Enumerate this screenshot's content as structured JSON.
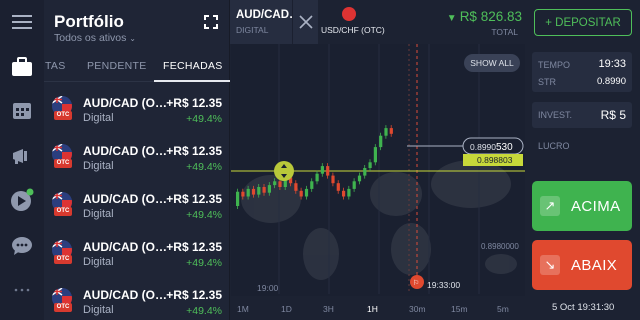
{
  "portfolio": {
    "title": "Portfólio",
    "subtitle": "Todos os ativos",
    "tabs": [
      {
        "label": "TAS"
      },
      {
        "label": "PENDENTE"
      },
      {
        "label": "FECHADAS"
      }
    ],
    "active_tab": "FECHADAS",
    "trades": [
      {
        "pair": "AUD/CAD (O…",
        "type": "Digital",
        "amount": "+R$ 12.35",
        "percent": "+49.4%",
        "badge": "OTC"
      },
      {
        "pair": "AUD/CAD (O…",
        "type": "Digital",
        "amount": "+R$ 12.35",
        "percent": "+49.4%",
        "badge": "OTC"
      },
      {
        "pair": "AUD/CAD (O…",
        "type": "Digital",
        "amount": "+R$ 12.35",
        "percent": "+49.4%",
        "badge": "OTC"
      },
      {
        "pair": "AUD/CAD (O…",
        "type": "Digital",
        "amount": "+R$ 12.35",
        "percent": "+49.4%",
        "badge": "OTC"
      },
      {
        "pair": "AUD/CAD (O…",
        "type": "Digital",
        "amount": "+R$ 12.35",
        "percent": "+49.4%",
        "badge": "OTC"
      }
    ]
  },
  "nav": {
    "icons": [
      "menu-icon",
      "briefcase-icon",
      "calendar-icon",
      "megaphone-icon",
      "video-play-icon",
      "chat-icon",
      "more-icon"
    ]
  },
  "header": {
    "asset_tab": {
      "name": "AUD/CAD…",
      "kind": "DIGITAL"
    },
    "asset_tab2": {
      "name": "USD/CHF (OTC)",
      "badge": "OTC"
    },
    "balance": "R$ 826.83",
    "balance_label": "TOTAL",
    "deposit_label": "+ DEPOSITAR"
  },
  "chart": {
    "show_all_label": "SHOW ALL",
    "current_price": "0.8990530",
    "current_price_main": "0.8990",
    "current_price_tail": "530",
    "strike_price": "0.898803",
    "axis_price": "0.8980000",
    "time_label_left": "19:00",
    "expiry_time": "19:33:00",
    "timeframes": [
      "1M",
      "1D",
      "3H",
      "1H",
      "30m",
      "15m",
      "5m"
    ],
    "active_timeframe": "1H"
  },
  "controls": {
    "time_label": "TEMPO",
    "time_value": "19:33",
    "str_label": "STR",
    "str_value": "0.8990",
    "invest_label": "INVEST.",
    "invest_value": "R$ 5",
    "profit_label": "LUCRO",
    "up_label": "ACIMA",
    "down_label": "ABAIX",
    "clock": "5 Oct 19:31:30"
  },
  "colors": {
    "up": "#3fb34f",
    "down": "#e0492f",
    "strike_line": "#c8d93a",
    "accent_green": "#4fbf5a"
  },
  "chart_data": {
    "type": "candlestick",
    "candles": [
      {
        "o": 0.4,
        "c": 0.55
      },
      {
        "o": 0.55,
        "c": 0.5
      },
      {
        "o": 0.5,
        "c": 0.58
      },
      {
        "o": 0.58,
        "c": 0.52
      },
      {
        "o": 0.52,
        "c": 0.6
      },
      {
        "o": 0.6,
        "c": 0.54
      },
      {
        "o": 0.54,
        "c": 0.62
      },
      {
        "o": 0.62,
        "c": 0.66
      },
      {
        "o": 0.66,
        "c": 0.6
      },
      {
        "o": 0.6,
        "c": 0.7
      },
      {
        "o": 0.7,
        "c": 0.64
      },
      {
        "o": 0.64,
        "c": 0.56
      },
      {
        "o": 0.56,
        "c": 0.5
      },
      {
        "o": 0.5,
        "c": 0.58
      },
      {
        "o": 0.58,
        "c": 0.66
      },
      {
        "o": 0.66,
        "c": 0.74
      },
      {
        "o": 0.74,
        "c": 0.82
      },
      {
        "o": 0.82,
        "c": 0.72
      },
      {
        "o": 0.72,
        "c": 0.64
      },
      {
        "o": 0.64,
        "c": 0.56
      },
      {
        "o": 0.56,
        "c": 0.5
      },
      {
        "o": 0.5,
        "c": 0.58
      },
      {
        "o": 0.58,
        "c": 0.66
      },
      {
        "o": 0.66,
        "c": 0.72
      },
      {
        "o": 0.72,
        "c": 0.8
      },
      {
        "o": 0.8,
        "c": 0.86
      },
      {
        "o": 0.86,
        "c": 1.02
      },
      {
        "o": 1.02,
        "c": 1.14
      },
      {
        "o": 1.14,
        "c": 1.22
      },
      {
        "o": 1.22,
        "c": 1.16
      }
    ]
  }
}
